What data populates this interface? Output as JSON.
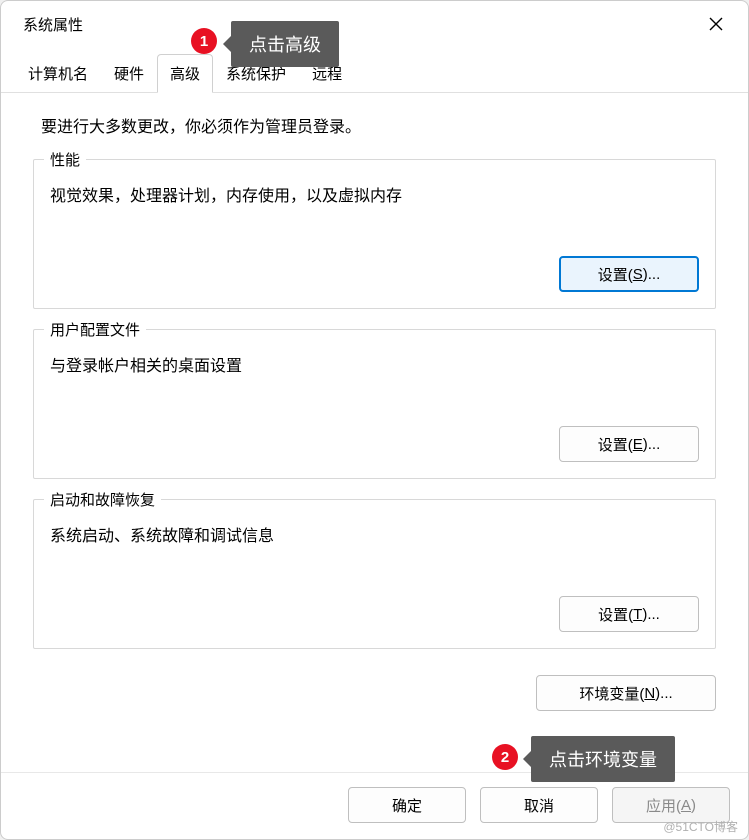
{
  "title": "系统属性",
  "tabs": {
    "computerName": "计算机名",
    "hardware": "硬件",
    "advanced": "高级",
    "systemProtection": "系统保护",
    "remote": "远程"
  },
  "adminNote": "要进行大多数更改，你必须作为管理员登录。",
  "performance": {
    "legend": "性能",
    "desc": "视觉效果，处理器计划，内存使用，以及虚拟内存",
    "button": "设置(S)..."
  },
  "userProfile": {
    "legend": "用户配置文件",
    "desc": "与登录帐户相关的桌面设置",
    "button": "设置(E)..."
  },
  "startup": {
    "legend": "启动和故障恢复",
    "desc": "系统启动、系统故障和调试信息",
    "button": "设置(T)..."
  },
  "envVars": "环境变量(N)...",
  "footer": {
    "ok": "确定",
    "cancel": "取消",
    "apply": "应用(A)"
  },
  "annotations": {
    "badge1": "1",
    "tip1": "点击高级",
    "badge2": "2",
    "tip2": "点击环境变量"
  },
  "watermark": "@51CTO博客"
}
